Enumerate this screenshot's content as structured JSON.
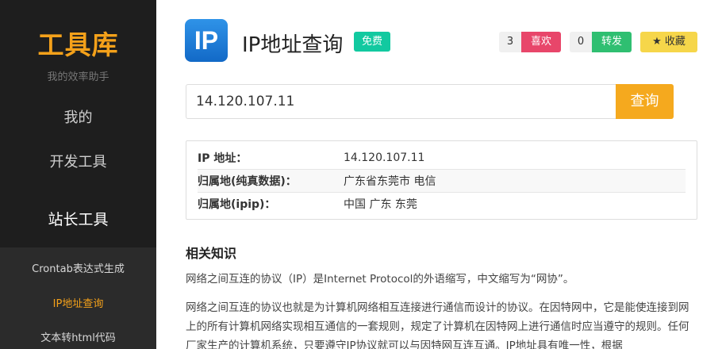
{
  "sidebar": {
    "logo": "工具库",
    "slogan": "我的效率助手",
    "nav": {
      "mine": "我的",
      "dev_tools": "开发工具",
      "webmaster_tools": "站长工具"
    },
    "submenu": [
      {
        "label": "Crontab表达式生成"
      },
      {
        "label": "IP地址查询",
        "active": true
      },
      {
        "label": "文本转html代码"
      }
    ]
  },
  "header": {
    "app_icon_text": "IP",
    "title": "IP地址查询",
    "badge": "免费",
    "like": {
      "count": "3",
      "label": "喜欢"
    },
    "share": {
      "count": "0",
      "label": "转发"
    },
    "favorite": {
      "label": "收藏",
      "icon": "star-icon"
    }
  },
  "search": {
    "value": "14.120.107.11",
    "button": "查询"
  },
  "result": {
    "rows": [
      {
        "key": "IP 地址：",
        "value": "14.120.107.11"
      },
      {
        "key": "归属地(纯真数据)：",
        "value": "广东省东莞市 电信"
      },
      {
        "key": "归属地(ipip)：",
        "value": "中国 广东 东莞"
      }
    ]
  },
  "knowledge": {
    "title": "相关知识",
    "p1": "网络之间互连的协议（IP）是Internet Protocol的外语缩写，中文缩写为“网协”。",
    "p2": "网络之间互连的协议也就是为计算机网络相互连接进行通信而设计的协议。在因特网中，它是能使连接到网上的所有计算机网络实现相互通信的一套规则，规定了计算机在因特网上进行通信时应当遵守的规则。任何厂家生产的计算机系统，只要遵守IP协议就可以与因特网互连互通。IP地址具有唯一性，根据"
  },
  "colors": {
    "accent": "#f4a11a",
    "badge": "#12c9a0",
    "like": "#e8466a",
    "share": "#2fbf71",
    "favorite": "#f6d64a",
    "sidebar_bg": "#1e1e1e"
  }
}
